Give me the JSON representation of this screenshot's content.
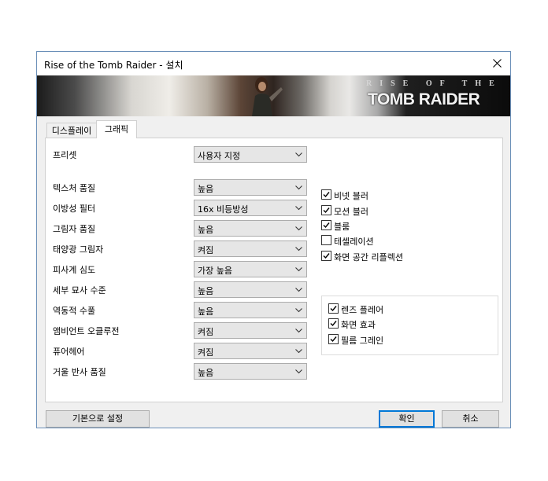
{
  "window": {
    "title": "Rise of the Tomb Raider - 설치"
  },
  "banner": {
    "logo_top": "RISE OF THE",
    "logo_main": "TOMB RAIDER"
  },
  "tabs": [
    {
      "label": "디스플레이",
      "active": false
    },
    {
      "label": "그래픽",
      "active": true
    }
  ],
  "preset": {
    "label": "프리셋",
    "value": "사용자 지정"
  },
  "settings": [
    {
      "label": "텍스처 품질",
      "value": "높음"
    },
    {
      "label": "이방성 필터",
      "value": "16x 비등방성"
    },
    {
      "label": "그림자 품질",
      "value": "높음"
    },
    {
      "label": "태양광 그림자",
      "value": "켜짐"
    },
    {
      "label": "피사계 심도",
      "value": "가장 높음"
    },
    {
      "label": "세부 묘사 수준",
      "value": "높음"
    },
    {
      "label": "역동적 수풀",
      "value": "높음"
    },
    {
      "label": "앰비언트 오클루전",
      "value": "켜짐"
    },
    {
      "label": "퓨어헤어",
      "value": "켜짐"
    },
    {
      "label": "거울 반사 품질",
      "value": "높음"
    }
  ],
  "checkboxes": [
    {
      "label": "비넷 블러",
      "checked": true
    },
    {
      "label": "모션 블러",
      "checked": true
    },
    {
      "label": "블룸",
      "checked": true
    },
    {
      "label": "테셀레이션",
      "checked": false
    },
    {
      "label": "화면 공간 리플렉션",
      "checked": true
    }
  ],
  "group_checkboxes": [
    {
      "label": "렌즈 플레어",
      "checked": true
    },
    {
      "label": "화면 효과",
      "checked": true
    },
    {
      "label": "필름 그레인",
      "checked": true
    }
  ],
  "buttons": {
    "defaults": "기본으로 설정",
    "ok": "확인",
    "cancel": "취소"
  },
  "icons": {
    "close": "close-icon",
    "dropdown": "chevron-down-icon",
    "check": "check-icon"
  },
  "colors": {
    "accent": "#0078d7",
    "window_border": "#6a8fb8"
  }
}
